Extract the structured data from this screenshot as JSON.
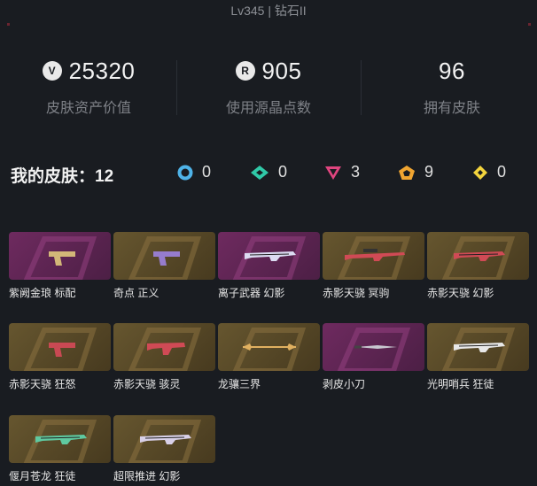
{
  "header": {
    "level_text": "Lv345 | 钻石II"
  },
  "stats": [
    {
      "icon": "valorant-points-icon",
      "icon_glyph": "V",
      "value": "25320",
      "label": "皮肤资产价值"
    },
    {
      "icon": "radianite-points-icon",
      "icon_glyph": "R",
      "value": "905",
      "label": "使用源晶点数"
    },
    {
      "icon": "",
      "icon_glyph": "",
      "value": "96",
      "label": "拥有皮肤"
    }
  ],
  "skins_summary": {
    "title": "我的皮肤：",
    "count": "12",
    "tiers": [
      {
        "name": "select-tier-icon",
        "color": "#4fb3e8",
        "count": "0"
      },
      {
        "name": "deluxe-tier-icon",
        "color": "#30c9a8",
        "count": "0"
      },
      {
        "name": "premium-tier-icon",
        "color": "#e0457f",
        "count": "3"
      },
      {
        "name": "exclusive-tier-icon",
        "color": "#f0a531",
        "count": "9"
      },
      {
        "name": "ultra-tier-icon",
        "color": "#f3d43d",
        "count": "0"
      }
    ]
  },
  "skins": [
    {
      "name": "紫阙金琅 标配",
      "bg": "purple",
      "weapon": "pistol",
      "accent": "#d9c07a"
    },
    {
      "name": "奇点 正义",
      "bg": "gold",
      "weapon": "pistol",
      "accent": "#9a7fd6"
    },
    {
      "name": "离子武器 幻影",
      "bg": "purple",
      "weapon": "rifle",
      "accent": "#dcdcf2"
    },
    {
      "name": "赤影天骁 冥驹",
      "bg": "gold",
      "weapon": "sniper",
      "accent": "#d04a55"
    },
    {
      "name": "赤影天骁 幻影",
      "bg": "gold",
      "weapon": "rifle",
      "accent": "#d04a55"
    },
    {
      "name": "赤影天骁 狂怒",
      "bg": "gold",
      "weapon": "pistol",
      "accent": "#d04a55"
    },
    {
      "name": "赤影天骁 骇灵",
      "bg": "gold",
      "weapon": "smg",
      "accent": "#d04a55"
    },
    {
      "name": "龙骧三界",
      "bg": "gold",
      "weapon": "staff",
      "accent": "#e0b060"
    },
    {
      "name": "剥皮小刀",
      "bg": "purple",
      "weapon": "knife",
      "accent": "#c8c8d0"
    },
    {
      "name": "光明哨兵 狂徒",
      "bg": "gold",
      "weapon": "rifle",
      "accent": "#e8e8e8"
    },
    {
      "name": "偃月苍龙 狂徒",
      "bg": "gold",
      "weapon": "rifle",
      "accent": "#5fc9a0"
    },
    {
      "name": "超限推进 幻影",
      "bg": "gold",
      "weapon": "rifle",
      "accent": "#d8d0e8"
    }
  ]
}
